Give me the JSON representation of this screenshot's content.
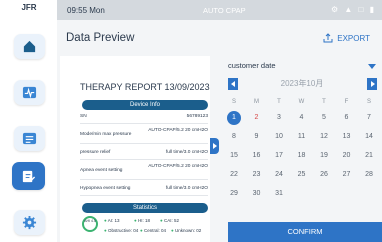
{
  "app": {
    "logo": "JFR"
  },
  "statusbar": {
    "time": "09:55 Mon",
    "mode": "AUTO CPAP",
    "icons": "⚙ ▲ □ ▮"
  },
  "header": {
    "title": "Data Preview",
    "export_label": "EXPORT"
  },
  "report": {
    "title": "THERAPY REPORT  13/09/2023",
    "device_info_label": "Device Info",
    "rows": [
      {
        "key": "SN",
        "value": "56789123"
      },
      {
        "key": "Mode/min max pressure",
        "value": "AUTO-CPAP/5.2 20 cmH2O"
      },
      {
        "key": "pressure relief",
        "value": "full time/3.0 cmH2O"
      },
      {
        "key": "Apnea event setting",
        "value": "AUTO-CPAP/5.2 20 cmH2O"
      },
      {
        "key": "Hypopnea event setting",
        "value": "full time/3.0 cmH2O"
      }
    ],
    "statistics_label": "Statistics",
    "donut_label": "AHI 4.5",
    "stats": {
      "ai": "AI: 13",
      "hi": "HI: 18",
      "cai": "CAI: 52",
      "obstructive": "Obstructive: 04",
      "central": "Central: 04",
      "unknown": "Unknown: 02"
    }
  },
  "calendar": {
    "dropdown_value": "customer date",
    "month_label": "2023年10月",
    "weekdays": [
      "S",
      "M",
      "T",
      "W",
      "T",
      "F",
      "S"
    ],
    "weeks": [
      [
        "1",
        "2",
        "3",
        "4",
        "5",
        "6",
        "7"
      ],
      [
        "8",
        "9",
        "10",
        "11",
        "12",
        "13",
        "14"
      ],
      [
        "15",
        "16",
        "17",
        "18",
        "19",
        "20",
        "21"
      ],
      [
        "22",
        "23",
        "24",
        "25",
        "26",
        "27",
        "28"
      ],
      [
        "29",
        "30",
        "31",
        "",
        "",
        "",
        ""
      ]
    ],
    "selected_day": "1",
    "today_day": "2",
    "confirm_label": "CONFIRM"
  },
  "colors": {
    "accent": "#2e74c6",
    "section": "#1b5e8c",
    "today": "#d64545"
  }
}
